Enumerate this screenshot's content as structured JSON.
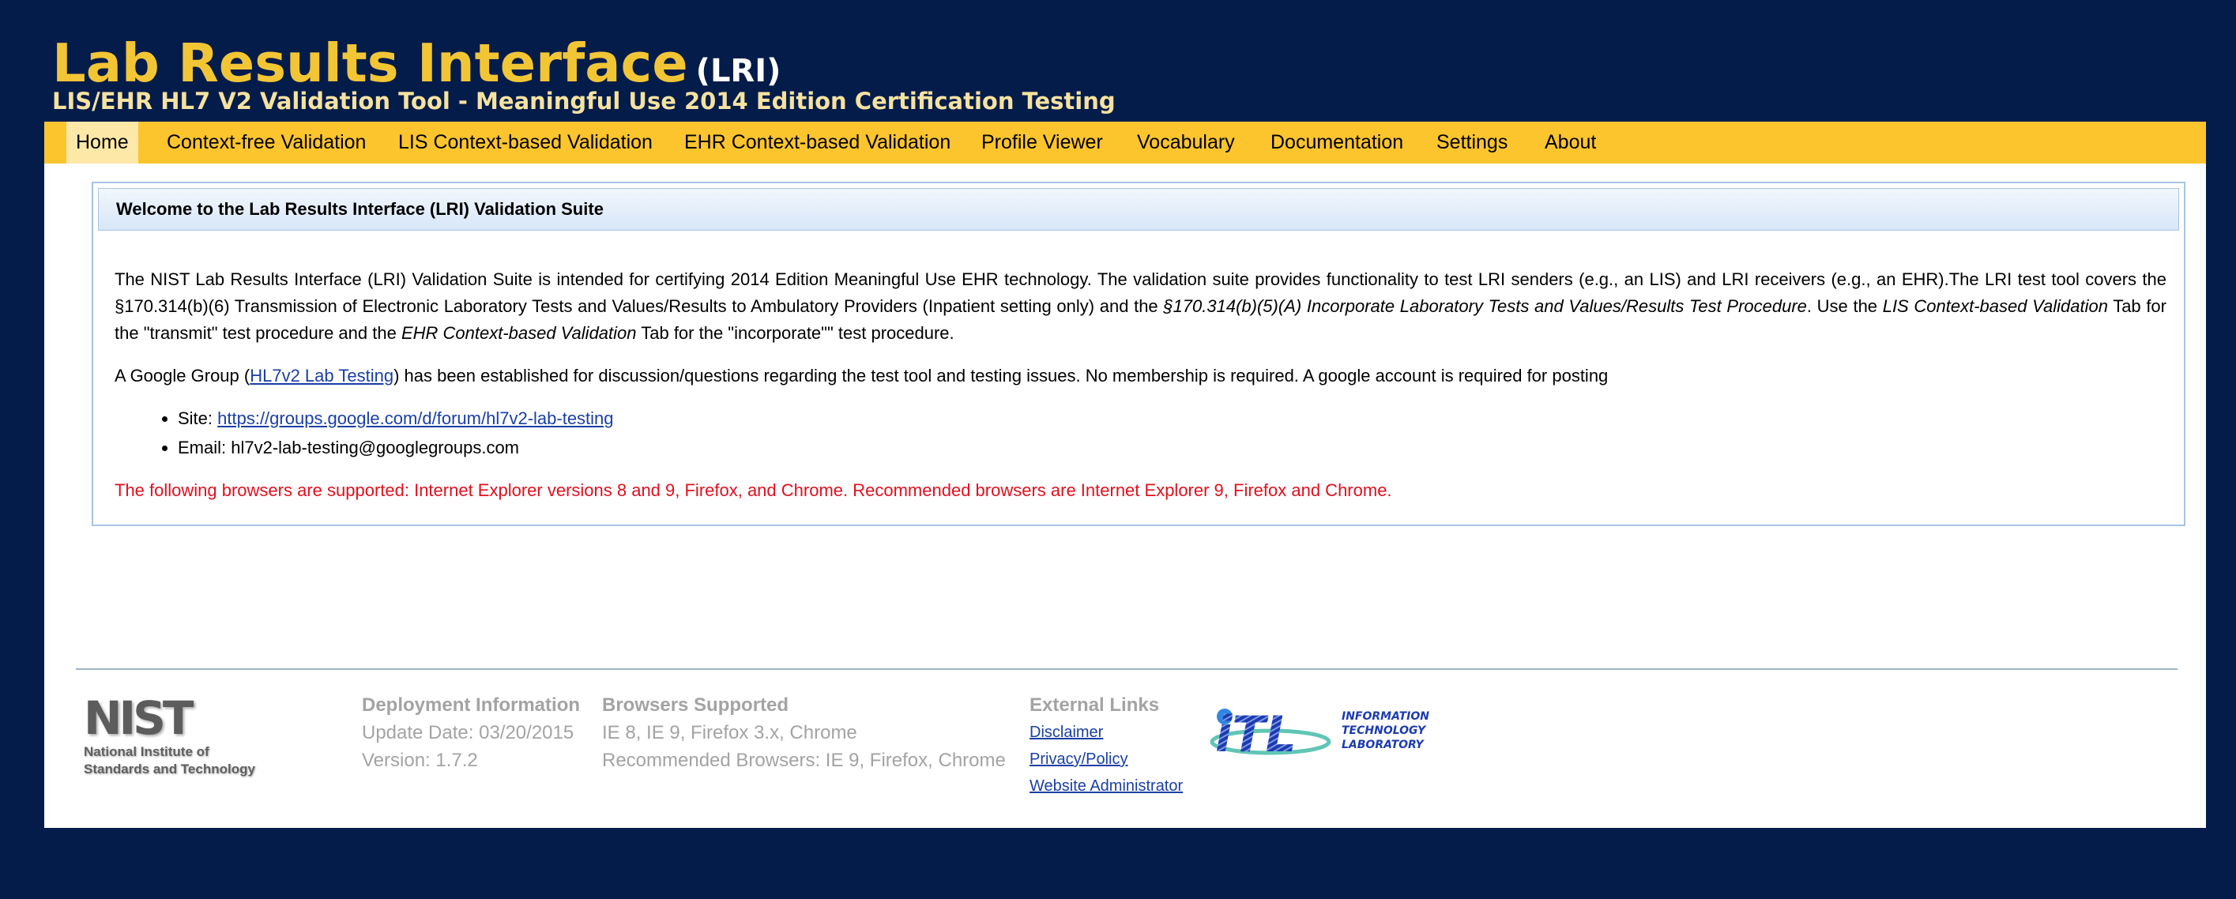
{
  "header": {
    "title": "Lab Results Interface",
    "title_abbr": "(LRI)",
    "subtitle": "LIS/EHR HL7 V2 Validation Tool - Meaningful Use 2014 Edition Certification Testing"
  },
  "nav": {
    "items": [
      {
        "label": "Home",
        "active": true
      },
      {
        "label": "Context-free Validation"
      },
      {
        "label": "LIS Context-based Validation"
      },
      {
        "label": "EHR Context-based Validation"
      },
      {
        "label": "Profile Viewer"
      },
      {
        "label": "Vocabulary"
      },
      {
        "label": "Documentation"
      },
      {
        "label": "Settings"
      },
      {
        "label": "About"
      }
    ]
  },
  "welcome": {
    "heading": "Welcome to the Lab Results Interface (LRI) Validation Suite",
    "para1": {
      "part1": "The NIST Lab Results Interface (LRI) Validation Suite is intended for certifying 2014 Edition Meaningful Use EHR technology. The validation suite provides functionality to test LRI senders (e.g., an LIS) and LRI receivers (e.g., an EHR).The LRI test tool covers the §170.314(b)(6) Transmission of Electronic Laboratory Tests and Values/Results to Ambulatory Providers (Inpatient setting only) and the ",
      "em1": "§170.314(b)(5)(A) Incorporate Laboratory Tests and Values/Results Test Procedure",
      "part2": ". Use the ",
      "em2": "LIS Context-based Validation",
      "part3": " Tab for the \"transmit\" test procedure and the ",
      "em3": "EHR Context-based Validation",
      "part4": " Tab for the \"incorporate\"\" test procedure."
    },
    "para2": {
      "before": "A Google Group (",
      "link": "HL7v2 Lab Testing",
      "after": ") has been established for discussion/questions regarding the test tool and testing issues. No membership is required. A google account is required for posting"
    },
    "site_label": "Site: ",
    "site_url": "https://groups.google.com/d/forum/hl7v2-lab-testing",
    "email_label": "Email: ",
    "email": "hl7v2-lab-testing@googlegroups.com",
    "browser_warning": "The following browsers are supported: Internet Explorer versions 8 and 9, Firefox, and Chrome. Recommended browsers are Internet Explorer 9, Firefox and Chrome."
  },
  "footer": {
    "nist_logo_word": "NIST",
    "nist_logo_sub1": "National Institute of",
    "nist_logo_sub2": "Standards and Technology",
    "deployment": {
      "heading": "Deployment Information",
      "update": "Update Date: 03/20/2015",
      "version": "Version: 1.7.2"
    },
    "browsers": {
      "heading": "Browsers Supported",
      "supported": "IE 8, IE 9, Firefox 3.x, Chrome",
      "recommended": "Recommended Browsers: IE 9, Firefox, Chrome"
    },
    "external": {
      "heading": "External Links",
      "links": [
        "Disclaimer",
        "Privacy/Policy",
        "Website Administrator"
      ]
    },
    "itl_logo_word": "iTL",
    "itl_logo_line1": "INFORMATION",
    "itl_logo_line2": "TECHNOLOGY",
    "itl_logo_line3": "LABORATORY"
  },
  "colors": {
    "background": "#041c4a",
    "title": "#f2c535",
    "navbar": "#fcc52e",
    "warning": "#e0101e",
    "link": "#1a3fa5"
  }
}
